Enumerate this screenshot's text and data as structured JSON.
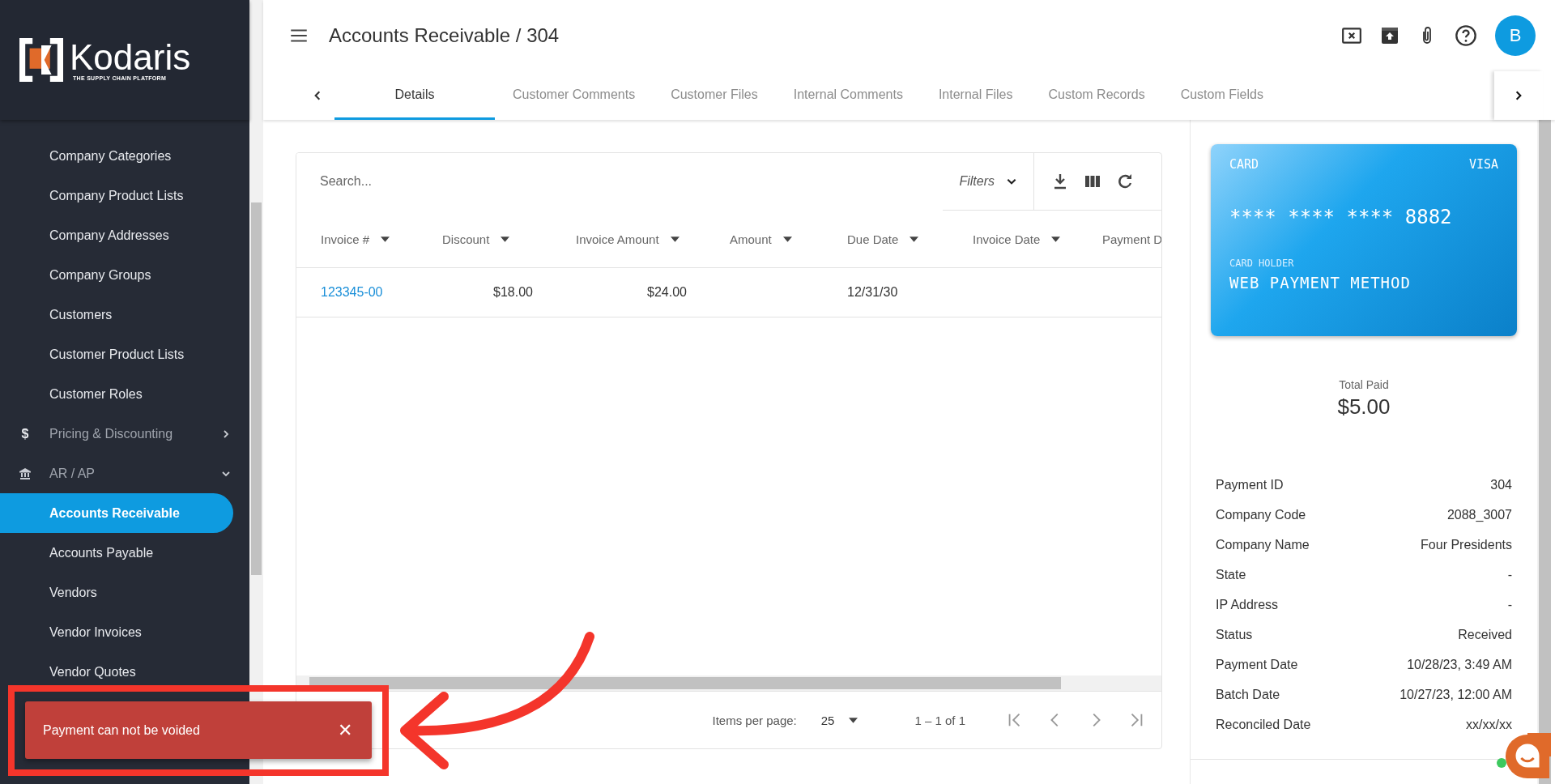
{
  "sidebar": {
    "logo": {
      "name": "Kodaris",
      "tagline": "THE SUPPLY CHAIN PLATFORM"
    },
    "items": [
      {
        "label": "Company Categories",
        "kind": "link",
        "selected": false
      },
      {
        "label": "Company Product Lists",
        "kind": "link",
        "selected": false
      },
      {
        "label": "Company Addresses",
        "kind": "link",
        "selected": false
      },
      {
        "label": "Company Groups",
        "kind": "link",
        "selected": false
      },
      {
        "label": "Customers",
        "kind": "link",
        "selected": false
      },
      {
        "label": "Customer Product Lists",
        "kind": "link",
        "selected": false
      },
      {
        "label": "Customer Roles",
        "kind": "link",
        "selected": false
      },
      {
        "label": "Pricing & Discounting",
        "kind": "money",
        "symbol": "$",
        "expanded": false
      },
      {
        "label": "AR / AP",
        "kind": "bank",
        "expanded": true
      },
      {
        "label": "Accounts Receivable",
        "kind": "link",
        "selected": true
      },
      {
        "label": "Accounts Payable",
        "kind": "link",
        "selected": false
      },
      {
        "label": "Vendors",
        "kind": "link",
        "selected": false
      },
      {
        "label": "Vendor Invoices",
        "kind": "link",
        "selected": false
      },
      {
        "label": "Vendor Quotes",
        "kind": "link",
        "selected": false
      }
    ]
  },
  "header": {
    "title": "Accounts Receivable / 304",
    "avatar": "B"
  },
  "tabs": [
    {
      "label": "Details",
      "selected": true
    },
    {
      "label": "Customer Comments",
      "selected": false
    },
    {
      "label": "Customer Files",
      "selected": false
    },
    {
      "label": "Internal Comments",
      "selected": false
    },
    {
      "label": "Internal Files",
      "selected": false
    },
    {
      "label": "Custom Records",
      "selected": false
    },
    {
      "label": "Custom Fields",
      "selected": false
    }
  ],
  "table": {
    "search": {
      "placeholder": "Search..."
    },
    "filters": "Filters",
    "columns": [
      {
        "label": "Invoice #",
        "sortable": true
      },
      {
        "label": "Discount",
        "sortable": true
      },
      {
        "label": "Invoice Amount",
        "sortable": true
      },
      {
        "label": "Amount",
        "sortable": true
      },
      {
        "label": "Due Date",
        "sortable": true
      },
      {
        "label": "Invoice Date",
        "sortable": true
      },
      {
        "label": "Payment D",
        "sortable": false
      }
    ],
    "rows": [
      {
        "cells": [
          "123345-00",
          "$18.00",
          "$24.00",
          null,
          "12/31/30",
          null,
          null
        ]
      }
    ],
    "paginator": {
      "label": "Items per page:",
      "page_size": "25",
      "range": "1 – 1 of 1"
    }
  },
  "card": {
    "type": "CARD",
    "brand": "VISA",
    "number": "**** **** **** 8882",
    "holder_label": "CARD HOLDER",
    "holder": "WEB PAYMENT METHOD"
  },
  "total": {
    "label": "Total Paid",
    "value": "$5.00"
  },
  "details": [
    {
      "label": "Payment ID",
      "value": "304"
    },
    {
      "label": "Company Code",
      "value": "2088_3007"
    },
    {
      "label": "Company Name",
      "value": "Four Presidents"
    },
    {
      "label": "State",
      "value": "-"
    },
    {
      "label": "IP Address",
      "value": "-"
    },
    {
      "label": "Status",
      "value": "Received"
    },
    {
      "label": "Payment Date",
      "value": "10/28/23, 3:49 AM"
    },
    {
      "label": "Batch Date",
      "value": "10/27/23, 12:00 AM"
    },
    {
      "label": "Reconciled Date",
      "value": "xx/xx/xx"
    }
  ],
  "toast": {
    "message": "Payment can not be voided",
    "close": "✕"
  },
  "chat": {
    "online": true
  }
}
